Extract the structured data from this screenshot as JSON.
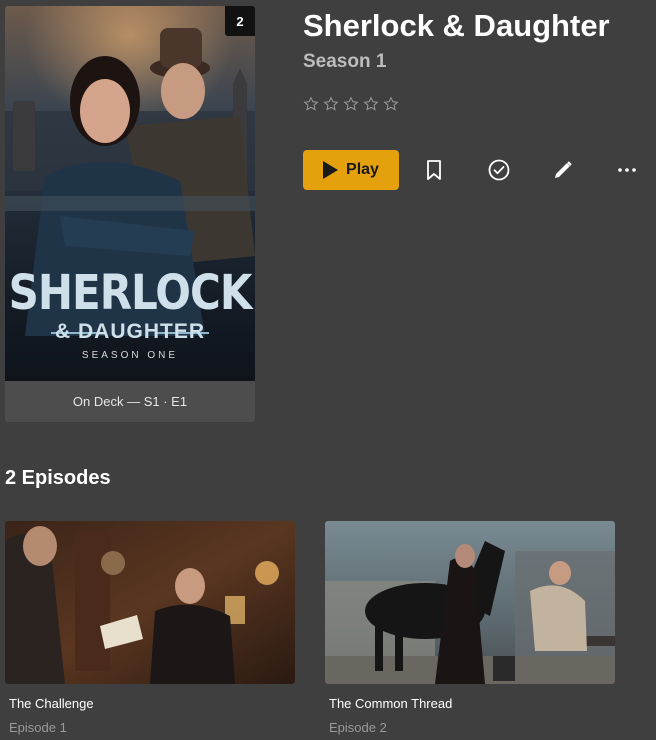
{
  "show": {
    "title": "Sherlock & Daughter",
    "season": "Season 1",
    "rating_stars": 0,
    "rating_max": 5
  },
  "poster": {
    "badge": "2",
    "art_title_line1": "SHERLOCK",
    "art_title_line2": "& DAUGHTER",
    "art_title_line3": "SEASON ONE",
    "on_deck": "On Deck — S1 · E1"
  },
  "actions": {
    "play_label": "Play",
    "icons": [
      "bookmark-icon",
      "check-circle-icon",
      "edit-icon",
      "more-icon"
    ]
  },
  "episodes_section": {
    "title": "2 Episodes",
    "items": [
      {
        "title": "The Challenge",
        "number": "Episode 1"
      },
      {
        "title": "The Common Thread",
        "number": "Episode 2"
      }
    ]
  },
  "colors": {
    "background": "#3f3f3f",
    "accent": "#e5a00d",
    "muted_text": "#9a9a9a"
  }
}
